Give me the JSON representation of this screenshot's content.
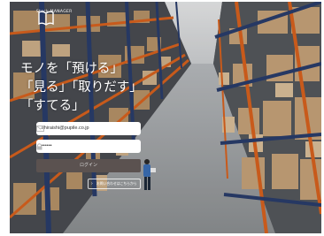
{
  "brand": {
    "name": "Stock MANAGER"
  },
  "hero": {
    "line1": "モノを「預ける」",
    "line2": "「見る」「取りだす」",
    "line3": "「すてる」"
  },
  "form": {
    "email_value": "shiraishi@pupile.co.jp",
    "password_value": "••••••",
    "login_label": "ログイン",
    "help_label": "お問い合わせはこちらから"
  },
  "colors": {
    "login_button": "#5b5250",
    "shelf_orange": "#d9621e",
    "shelf_blue": "#2a3d6c",
    "cardboard": "#c7a37a"
  }
}
